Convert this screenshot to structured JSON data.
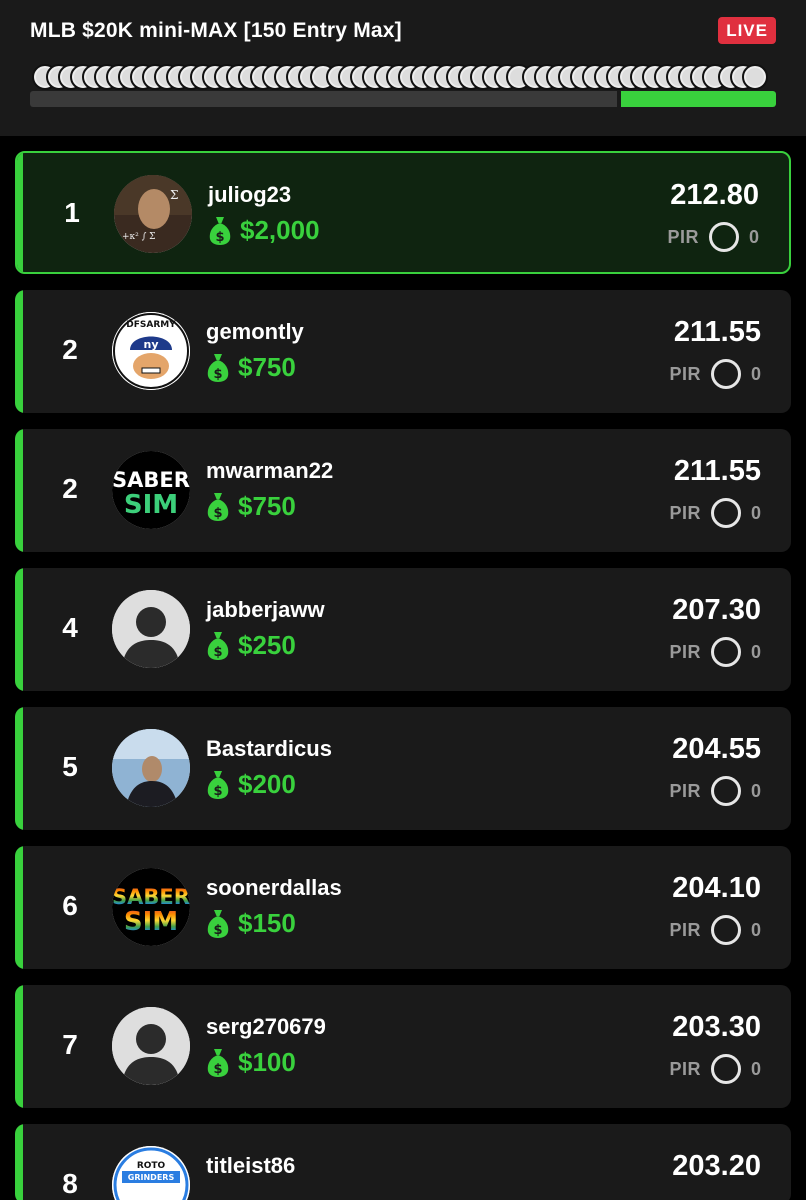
{
  "contest": {
    "title": "MLB $20K mini-MAX [150 Entry Max]",
    "status_badge": "LIVE"
  },
  "progress": {
    "fraction_complete": 0.21
  },
  "leaderboard": [
    {
      "rank": "1",
      "username": "juliog23",
      "prize": "$2,000",
      "score": "212.80",
      "pir_label": "PIR",
      "pir_value": "0",
      "avatar": "math-photo"
    },
    {
      "rank": "2",
      "username": "gemontly",
      "prize": "$750",
      "score": "211.55",
      "pir_label": "PIR",
      "pir_value": "0",
      "avatar": "dfsarmy-logo",
      "avatar_text": "DFSARMY"
    },
    {
      "rank": "2",
      "username": "mwarman22",
      "prize": "$750",
      "score": "211.55",
      "pir_label": "PIR",
      "pir_value": "0",
      "avatar": "sabersim-logo",
      "avatar_text": [
        "SABER",
        "SIM"
      ]
    },
    {
      "rank": "4",
      "username": "jabberjaww",
      "prize": "$250",
      "score": "207.30",
      "pir_label": "PIR",
      "pir_value": "0",
      "avatar": "default-silhouette"
    },
    {
      "rank": "5",
      "username": "Bastardicus",
      "prize": "$200",
      "score": "204.55",
      "pir_label": "PIR",
      "pir_value": "0",
      "avatar": "sky-photo"
    },
    {
      "rank": "6",
      "username": "soonerdallas",
      "prize": "$150",
      "score": "204.10",
      "pir_label": "PIR",
      "pir_value": "0",
      "avatar": "sabersim-rainbow-logo",
      "avatar_text": [
        "SABER",
        "SIM"
      ]
    },
    {
      "rank": "7",
      "username": "serg270679",
      "prize": "$100",
      "score": "203.30",
      "pir_label": "PIR",
      "pir_value": "0",
      "avatar": "default-silhouette"
    },
    {
      "rank": "8",
      "username": "titleist86",
      "prize": "",
      "score": "203.20",
      "pir_label": "",
      "pir_value": "",
      "avatar": "rotogrinders-logo",
      "avatar_text": [
        "ROTO",
        "GRINDERS"
      ]
    }
  ],
  "colors": {
    "accent": "#39d13d",
    "live": "#e0303f",
    "card": "#1a1a1a"
  }
}
